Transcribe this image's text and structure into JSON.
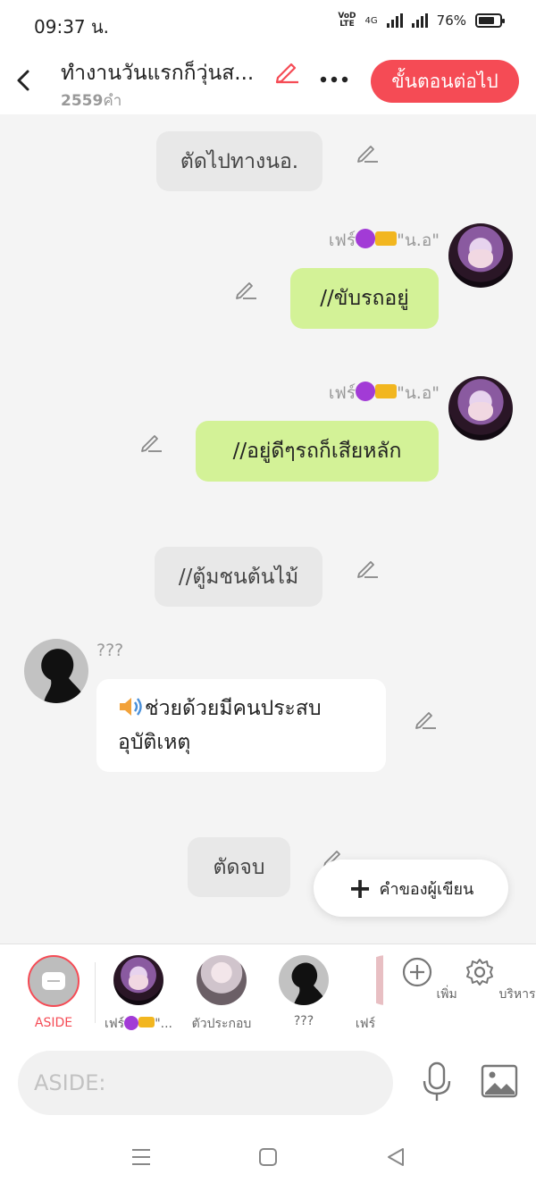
{
  "status_bar": {
    "time": "09:37 น.",
    "network": "4G",
    "battery": "76%",
    "battery_level": 0.76
  },
  "header": {
    "title": "ทำงานวันแรกก็วุ่นส...",
    "word_count": "2559",
    "word_unit": "คำ",
    "next_button": "ขั้นตอนต่อไป"
  },
  "messages": {
    "m1": "ตัดไปทางนอ.",
    "name1": "เฟร์",
    "name1_suffix": "\"น.อ\"",
    "m2": "//ขับรถอยู่",
    "name2": "เฟร์",
    "name2_suffix": "\"น.อ\"",
    "m3": "//อยู่ดีๆรถก็เสียหลัก",
    "m4": "//ตู้มชนต้นไม้",
    "name3": "???",
    "m5_line1": "ช่วยด้วยมีคนประสบ",
    "m5_line2": "อุบัติเหตุ",
    "m6": "ตัดจบ"
  },
  "fab": {
    "label": "คำของผู้เขียน"
  },
  "characters": {
    "aside": "ASIDE",
    "char1": "เฟร์",
    "char1_suffix": "\"...",
    "char2": "ตัวประกอบ",
    "char3": "???",
    "char4": "เฟร์",
    "add": "เพิ่ม",
    "manage": "บริหาร"
  },
  "input": {
    "placeholder": "ASIDE:"
  },
  "colors": {
    "accent": "#f54b55",
    "green_bubble": "#d3f297",
    "narration_bubble": "#e8e8e8"
  },
  "icons": [
    "back-icon",
    "pencil-icon",
    "more-icon",
    "plus-icon",
    "add-circle-icon",
    "gear-icon",
    "mic-icon",
    "image-icon",
    "menu-icon",
    "home-icon",
    "back-triangle-icon",
    "speaker-icon"
  ]
}
